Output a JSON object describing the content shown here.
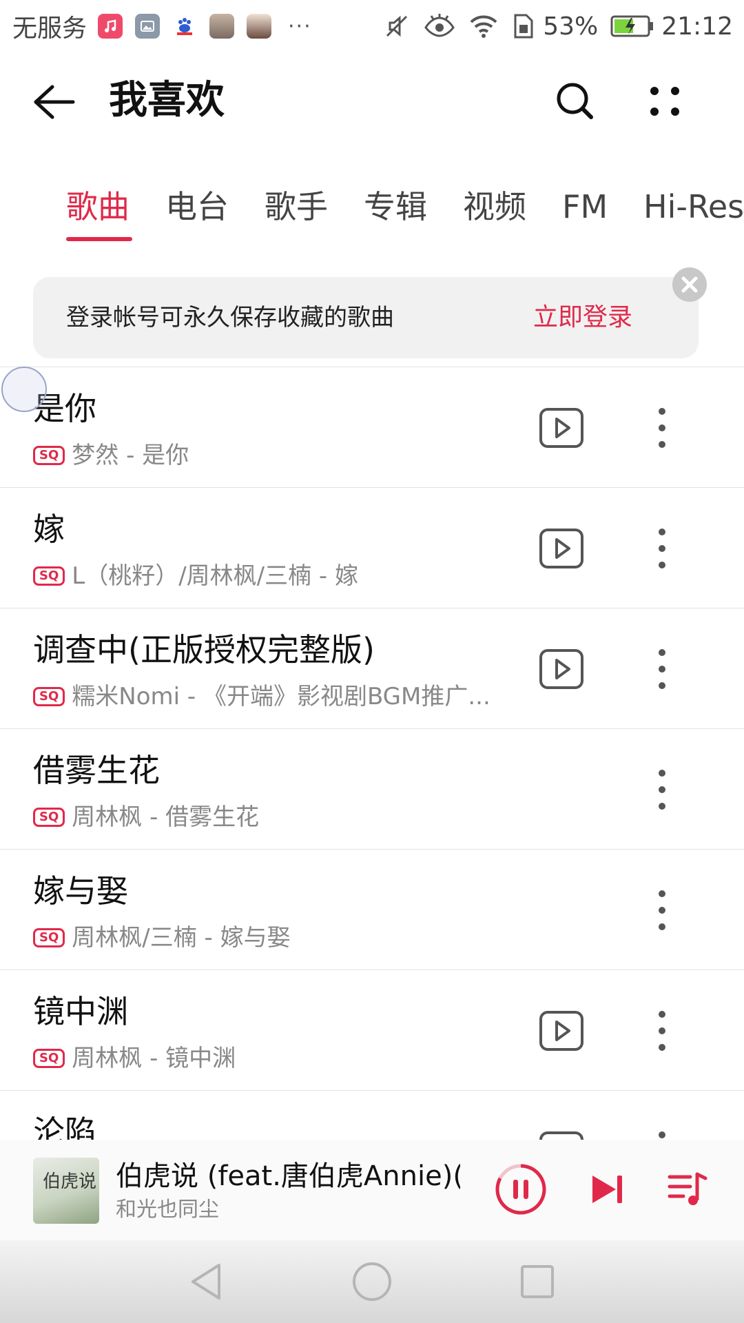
{
  "status_bar": {
    "carrier": "无服务",
    "more": "···",
    "battery": "53%",
    "time": "21:12",
    "icons": [
      "music-app-icon",
      "gallery-icon",
      "baidu-icon",
      "avatar-icon",
      "avatar-icon",
      "mute-icon",
      "eye-comfort-icon",
      "wifi-icon",
      "sim-icon",
      "battery-charging-icon"
    ]
  },
  "header": {
    "title": "我喜欢"
  },
  "tabs": [
    "歌曲",
    "电台",
    "歌手",
    "专辑",
    "视频",
    "FM",
    "Hi-Res"
  ],
  "active_tab": "歌曲",
  "banner": {
    "text": "登录帐号可永久保存收藏的歌曲",
    "action": "立即登录"
  },
  "badge": "SQ",
  "songs": [
    {
      "title": "是你",
      "artist": "梦然 - 是你",
      "has_video": true
    },
    {
      "title": "嫁",
      "artist": "L（桃籽）/周林枫/三楠 - 嫁",
      "has_video": true
    },
    {
      "title": "调查中(正版授权完整版)",
      "artist": "糯米Nomi - 《开端》影视剧BGM推广...",
      "has_video": true
    },
    {
      "title": "借雾生花",
      "artist": "周林枫 - 借雾生花",
      "has_video": false
    },
    {
      "title": "嫁与娶",
      "artist": "周林枫/三楠 - 嫁与娶",
      "has_video": false
    },
    {
      "title": "镜中渊",
      "artist": "周林枫 - 镜中渊",
      "has_video": true
    },
    {
      "title": "沦陷",
      "artist": "",
      "has_video": true
    }
  ],
  "now_playing": {
    "title": "伯虎说 (feat.唐伯虎Annie)(...",
    "artist": "和光也同尘",
    "cover_text": "伯虎说"
  },
  "colors": {
    "accent": "#e0294a",
    "text": "#111111",
    "secondary": "#888888"
  }
}
